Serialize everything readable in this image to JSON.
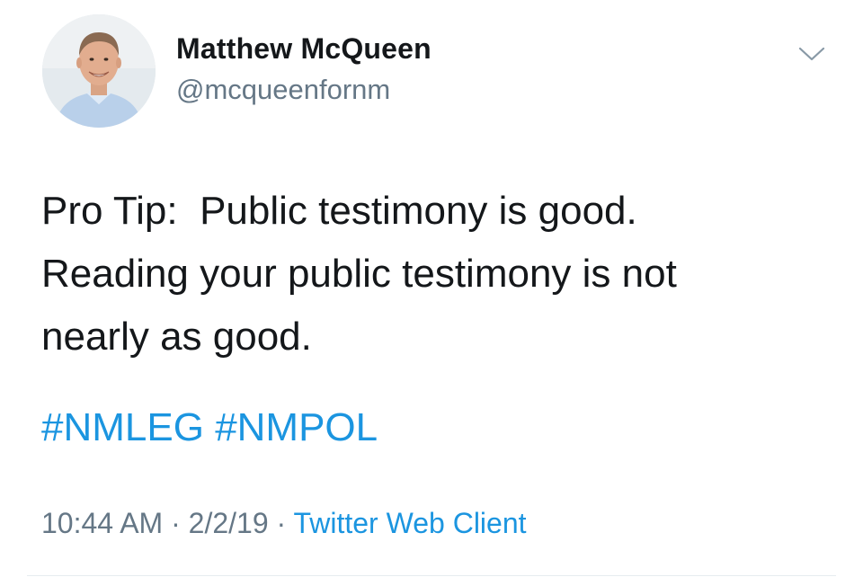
{
  "user": {
    "display_name": "Matthew McQueen",
    "handle": "@mcqueenfornm"
  },
  "icons": {
    "avatar": "profile-photo",
    "menu": "chevron-down-icon"
  },
  "tweet": {
    "lines": [
      "Pro Tip:  Public testimony is good.",
      "Reading your public testimony is not",
      "nearly as good."
    ],
    "hashtags": [
      "#NMLEG",
      "#NMPOL"
    ]
  },
  "meta": {
    "time": "10:44 AM",
    "separator": "·",
    "date": "2/2/19",
    "source": "Twitter Web Client"
  },
  "colors": {
    "text": "#14171a",
    "secondary": "#657786",
    "link": "#1b95e0"
  }
}
